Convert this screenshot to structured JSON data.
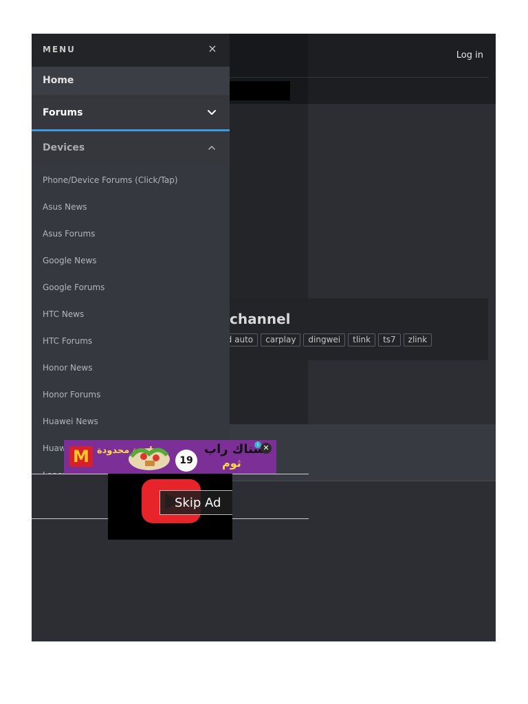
{
  "header": {
    "login_label": "Log in"
  },
  "thread": {
    "title": "channel",
    "tags": [
      "oid auto",
      "carplay",
      "dingwei",
      "tlink",
      "ts7",
      "zlink"
    ]
  },
  "menu": {
    "title": "MENU",
    "close_glyph": "×",
    "items": [
      {
        "label": "Home"
      },
      {
        "label": "Forums"
      },
      {
        "label": "Devices"
      }
    ],
    "devices_submenu": [
      "Phone/Device Forums (Click/Tap)",
      "Asus News",
      "Asus Forums",
      "Google News",
      "Google Forums",
      "HTC News",
      "HTC Forums",
      "Honor News",
      "Honor Forums",
      "Huawei News",
      "Huaw",
      "Lenov"
    ]
  },
  "ads": {
    "banner": {
      "logo_glyph": "M",
      "text_1": "لمدة محدودة",
      "price": "19",
      "text_2": "سناك راب",
      "text_3": "ثوم",
      "info_glyph": "i",
      "close_glyph": "✕"
    },
    "video": {
      "skip_label": "Skip Ad"
    }
  },
  "colors": {
    "menu_bg": "#3a3c43",
    "accent": "#3d9ae2",
    "header_bg": "#1d1e21",
    "page_bg": "#2c2e33"
  }
}
